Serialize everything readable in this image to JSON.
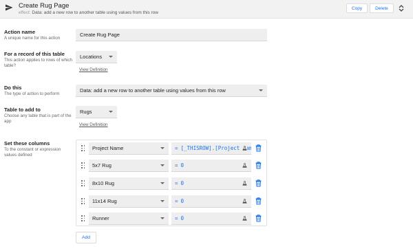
{
  "header": {
    "title": "Create Rug Page",
    "subtitle_prefix": "effect:",
    "subtitle": "Data: add a new row to another table using values from this row",
    "copy_label": "Copy",
    "delete_label": "Delete"
  },
  "action_name": {
    "label": "Action name",
    "help": "A unique name for this action",
    "value": "Create Rug Page"
  },
  "record_table": {
    "label": "For a record of this table",
    "help": "This action applies to rows of which table?",
    "value": "Locations",
    "link": "View Definition"
  },
  "do_this": {
    "label": "Do this",
    "help": "The type of action to perform",
    "value": "Data: add a new row to another table using values from this row"
  },
  "table_to_add": {
    "label": "Table to add to",
    "help": "Choose any table that is part of the app",
    "value": "Rugs",
    "link": "View Definition"
  },
  "set_columns": {
    "label": "Set these columns",
    "help": "To the constant or expression values defined",
    "rows": [
      {
        "column": "Project Name",
        "expr": "[_THISROW].[Project Name]"
      },
      {
        "column": "5x7 Rug",
        "expr": "0"
      },
      {
        "column": "8x10 Rug",
        "expr": "0"
      },
      {
        "column": "11x14 Rug",
        "expr": "0"
      },
      {
        "column": "Runner",
        "expr": "0"
      }
    ],
    "eq": "="
  },
  "add_label": "Add",
  "colors": {
    "accent": "#1a73e8",
    "header_bg": "#f2f2f2",
    "field_bg": "#eeeeee"
  },
  "icons": {
    "header": "send-icon",
    "sort": "unfold-icon",
    "row_drag": "drag-handle-icon",
    "row_test": "flask-icon",
    "row_delete": "trash-icon"
  }
}
